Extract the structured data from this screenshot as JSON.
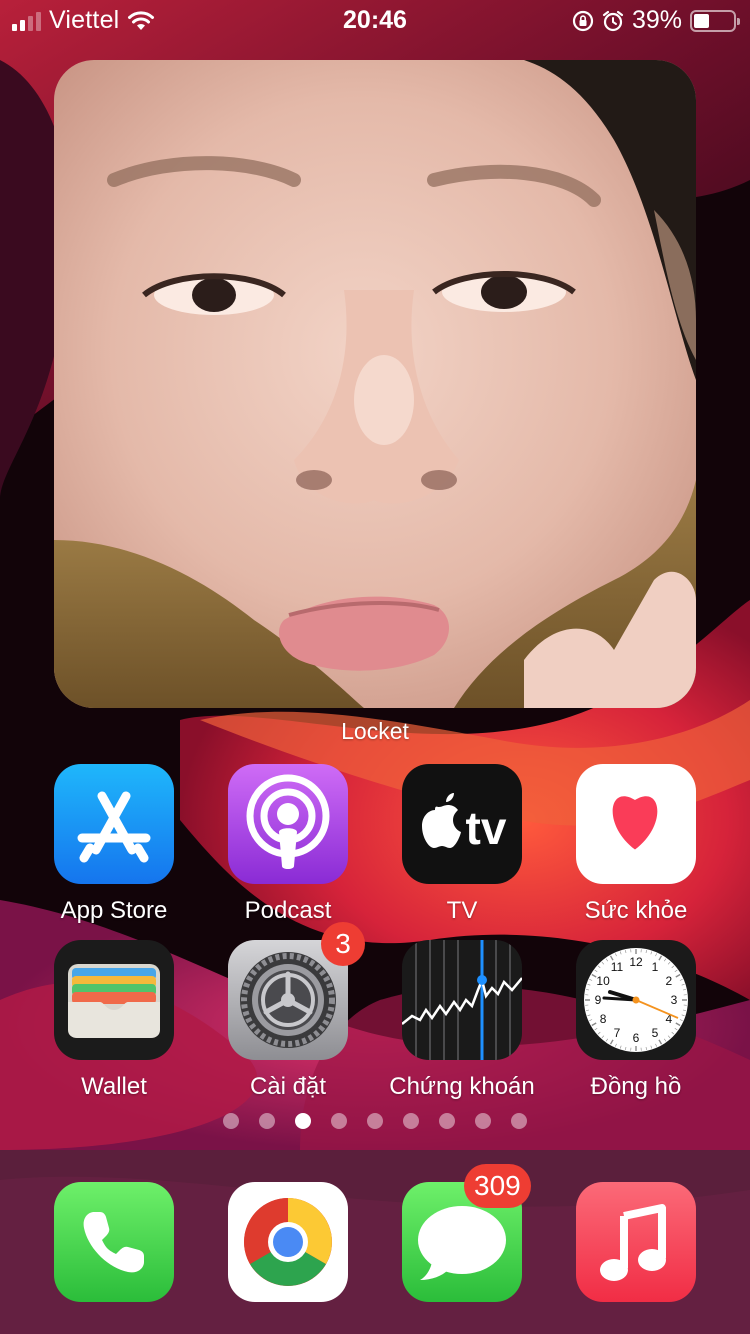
{
  "status_bar": {
    "carrier": "Viettel",
    "time": "20:46",
    "battery_percent": "39%",
    "battery_level": 0.39,
    "signal_bars": 2,
    "signal_bars_total": 4
  },
  "widget": {
    "label": "Locket",
    "image": "selfie-photo"
  },
  "apps": [
    {
      "label": "App Store",
      "icon": "app-store-icon"
    },
    {
      "label": "Podcast",
      "icon": "podcast-icon"
    },
    {
      "label": "TV",
      "icon": "apple-tv-icon",
      "icon_text": "tv"
    },
    {
      "label": "Sức khỏe",
      "icon": "health-heart-icon"
    },
    {
      "label": "Wallet",
      "icon": "wallet-icon"
    },
    {
      "label": "Cài đặt",
      "icon": "settings-gear-icon",
      "badge": "3"
    },
    {
      "label": "Chứng khoán",
      "icon": "stocks-chart-icon"
    },
    {
      "label": "Đồng hồ",
      "icon": "clock-icon",
      "clock_numbers": [
        "12",
        "1",
        "2",
        "3",
        "4",
        "5",
        "6",
        "7",
        "8",
        "9",
        "10",
        "11"
      ]
    }
  ],
  "page_dots": {
    "count": 9,
    "active_index": 2
  },
  "dock": [
    {
      "icon": "phone-icon"
    },
    {
      "icon": "chrome-icon"
    },
    {
      "icon": "messages-icon",
      "badge": "309"
    },
    {
      "icon": "music-icon"
    }
  ],
  "colors": {
    "badge": "#ee3d33",
    "wallpaper_red": "#c8283c",
    "wallpaper_dark": "#0b0308"
  }
}
